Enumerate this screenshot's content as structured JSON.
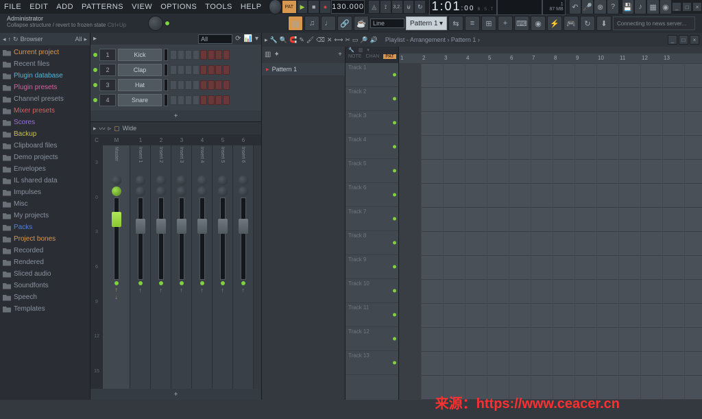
{
  "menu": [
    "FILE",
    "EDIT",
    "ADD",
    "PATTERNS",
    "VIEW",
    "OPTIONS",
    "TOOLS",
    "HELP"
  ],
  "transport": {
    "tempo": "130.000",
    "time": "1:01",
    "time_frac": ":00",
    "time_label": "B.S.T",
    "cpu": "1",
    "mem": "87 MB",
    "pattern_label": "PAT",
    "snap_label": "Line"
  },
  "hint": {
    "title": "Administrator",
    "text": "Collapse structure / revert to frozen state",
    "shortcut": "Ctrl+Up"
  },
  "pattern_selector": "Pattern 1",
  "news": "Connecting to news server...",
  "browser": {
    "title": "Browser",
    "filter": "All",
    "items": [
      {
        "label": "Current project",
        "cls": "orange"
      },
      {
        "label": "Recent files",
        "cls": "gray"
      },
      {
        "label": "Plugin database",
        "cls": "cyan"
      },
      {
        "label": "Plugin presets",
        "cls": "pink"
      },
      {
        "label": "Channel presets",
        "cls": "gray"
      },
      {
        "label": "Mixer presets",
        "cls": "red"
      },
      {
        "label": "Scores",
        "cls": "purple"
      },
      {
        "label": "Backup",
        "cls": "yellow"
      },
      {
        "label": "Clipboard files",
        "cls": "gray"
      },
      {
        "label": "Demo projects",
        "cls": "gray"
      },
      {
        "label": "Envelopes",
        "cls": "gray"
      },
      {
        "label": "IL shared data",
        "cls": "gray"
      },
      {
        "label": "Impulses",
        "cls": "gray"
      },
      {
        "label": "Misc",
        "cls": "gray"
      },
      {
        "label": "My projects",
        "cls": "gray"
      },
      {
        "label": "Packs",
        "cls": "blue"
      },
      {
        "label": "Project bones",
        "cls": "orange"
      },
      {
        "label": "Recorded",
        "cls": "gray"
      },
      {
        "label": "Rendered",
        "cls": "gray"
      },
      {
        "label": "Sliced audio",
        "cls": "gray"
      },
      {
        "label": "Soundfonts",
        "cls": "gray"
      },
      {
        "label": "Speech",
        "cls": "gray"
      },
      {
        "label": "Templates",
        "cls": "gray"
      }
    ]
  },
  "channel_rack": {
    "filter": "All",
    "channels": [
      {
        "num": "1",
        "name": "Kick"
      },
      {
        "num": "2",
        "name": "Clap"
      },
      {
        "num": "3",
        "name": "Hat"
      },
      {
        "num": "4",
        "name": "Snare"
      }
    ]
  },
  "mixer": {
    "view": "Wide",
    "ruler": [
      "C",
      "M",
      "1",
      "2",
      "3",
      "4",
      "5",
      "6"
    ],
    "db": [
      "3",
      "0",
      "3",
      "6",
      "9",
      "12",
      "15"
    ],
    "channels": [
      {
        "name": "Master",
        "master": true
      },
      {
        "name": "Insert 1"
      },
      {
        "name": "Insert 2"
      },
      {
        "name": "Insert 3"
      },
      {
        "name": "Insert 4"
      },
      {
        "name": "Insert 5"
      },
      {
        "name": "Insert 6"
      }
    ]
  },
  "playlist": {
    "title": "Playlist - Arrangement › Pattern 1 ›",
    "tabs": [
      "NOTE",
      "CHAN",
      "PAT"
    ],
    "patterns": [
      "Pattern 1"
    ],
    "ruler": [
      "1",
      "2",
      "3",
      "4",
      "5",
      "6",
      "7",
      "8",
      "9",
      "10",
      "11",
      "12",
      "13"
    ],
    "tracks": [
      "Track 1",
      "Track 2",
      "Track 3",
      "Track 4",
      "Track 5",
      "Track 6",
      "Track 7",
      "Track 8",
      "Track 9",
      "Track 10",
      "Track 11",
      "Track 12",
      "Track 13"
    ]
  },
  "watermark": "来源：https://www.ceacer.cn"
}
